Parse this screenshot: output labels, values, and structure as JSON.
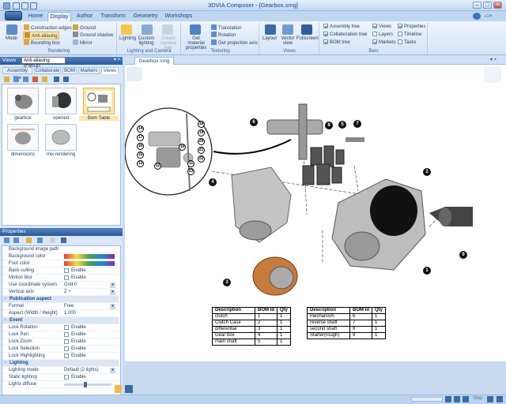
{
  "app": {
    "title": "3DVIA Composer - [Gearbox.smg]"
  },
  "tabs": [
    "Home",
    "Display",
    "Author",
    "Transform",
    "Geometry",
    "Workshops"
  ],
  "active_tab": "Display",
  "ribbon": {
    "rendering": {
      "label": "Rendering",
      "mode": "Mode",
      "construction_edges": "Construction edges",
      "anti_aliasing": "Anti-aliasing",
      "bounding_box": "Bounding box",
      "ground": "Ground",
      "ground_shadow": "Ground shadow",
      "mirror": "Mirror"
    },
    "lighting": {
      "label": "Lighting and Camera",
      "lighting": "Lighting",
      "custom_lighting": "Custom lighting",
      "create_camera_key": "Create camera key"
    },
    "texturing": {
      "label": "Texturing",
      "get_material": "Get material properties",
      "translation": "Translation",
      "rotation": "Rotation",
      "get_projection_axis": "Get projection axis"
    },
    "views": {
      "label": "Views",
      "layout": "Layout",
      "vector_view": "Vector view",
      "fullscreen": "Fullscreen"
    },
    "bars": {
      "label": "Bars",
      "assembly_tree": "Assembly tree",
      "collaboration_tree": "Collaboration tree",
      "bom_tree": "BOM tree",
      "views": "Views",
      "layers": "Layers",
      "markers": "Markers",
      "properties": "Properties",
      "timeline": "Timeline",
      "tasks": "Tasks"
    }
  },
  "left": {
    "views_header": "Views",
    "tooltip": "Anti-aliasing (Ctrl+A)",
    "subtabs": [
      "Assembly tree",
      "Collaborate",
      "BOM",
      "Markers",
      "Views"
    ],
    "active_subtab": "Views",
    "thumbnails": [
      "gearbox",
      "opened",
      "Bom Table",
      "dimensions",
      "mix rendering"
    ],
    "selected_thumbnail": "Bom Table"
  },
  "properties": {
    "header": "Properties",
    "rows": [
      {
        "k": "Background image path",
        "v": "",
        "type": "text"
      },
      {
        "k": "Background color",
        "v": "",
        "type": "gradient"
      },
      {
        "k": "Foot color",
        "v": "",
        "type": "gradient"
      },
      {
        "k": "Back culling",
        "v": "Enable",
        "type": "check"
      },
      {
        "k": "Motion blur",
        "v": "Enable",
        "type": "check"
      },
      {
        "k": "Use coordinate system",
        "v": "Grid 0",
        "type": "select"
      },
      {
        "k": "Vertical axis",
        "v": "Z +",
        "type": "select"
      },
      {
        "k": "Publication aspect",
        "v": "",
        "type": "cat"
      },
      {
        "k": "Format",
        "v": "Free",
        "type": "select"
      },
      {
        "k": "Aspect (Width / Height)",
        "v": "1.000",
        "type": "text"
      },
      {
        "k": "Event",
        "v": "",
        "type": "cat"
      },
      {
        "k": "Lock Rotation",
        "v": "Enable",
        "type": "check"
      },
      {
        "k": "Lock Pan",
        "v": "Enable",
        "type": "check"
      },
      {
        "k": "Lock Zoom",
        "v": "Enable",
        "type": "check"
      },
      {
        "k": "Lock Selection",
        "v": "Enable",
        "type": "check"
      },
      {
        "k": "Lock Highlighting",
        "v": "Enable",
        "type": "check"
      },
      {
        "k": "Lighting",
        "v": "",
        "type": "cat"
      },
      {
        "k": "Lighting mode",
        "v": "Default (2 lights)",
        "type": "select"
      },
      {
        "k": "Static lighting",
        "v": "Enable",
        "type": "check"
      },
      {
        "k": "Lights diffuse",
        "v": "",
        "type": "slider",
        "level": 0.45
      }
    ]
  },
  "document_tab": "Gearbox.smg",
  "callouts": [
    "1",
    "2",
    "3",
    "4",
    "5",
    "6",
    "7",
    "8",
    "9",
    "10",
    "11",
    "12",
    "13",
    "14",
    "15",
    "16",
    "17",
    "18",
    "19",
    "20",
    "21",
    "22",
    "23"
  ],
  "bom_left": {
    "headers": [
      "Description",
      "BOM Id",
      "Qty"
    ],
    "rows": [
      [
        "clutch",
        "1",
        "1"
      ],
      [
        "Clutch Case",
        "2",
        "1"
      ],
      [
        "differential",
        "3",
        "1"
      ],
      [
        "Gear box",
        "4",
        "1"
      ],
      [
        "main shaft",
        "5",
        "1"
      ]
    ]
  },
  "bom_right": {
    "headers": [
      "Description",
      "BOM Id",
      "Qty"
    ],
    "rows": [
      [
        "mechanism",
        "6",
        "1"
      ],
      [
        "reverse shaft",
        "7",
        "1"
      ],
      [
        "second shaft",
        "8",
        "1"
      ],
      [
        "Starter(rough)",
        "9",
        "1"
      ]
    ]
  },
  "status": {
    "step": "Step"
  }
}
